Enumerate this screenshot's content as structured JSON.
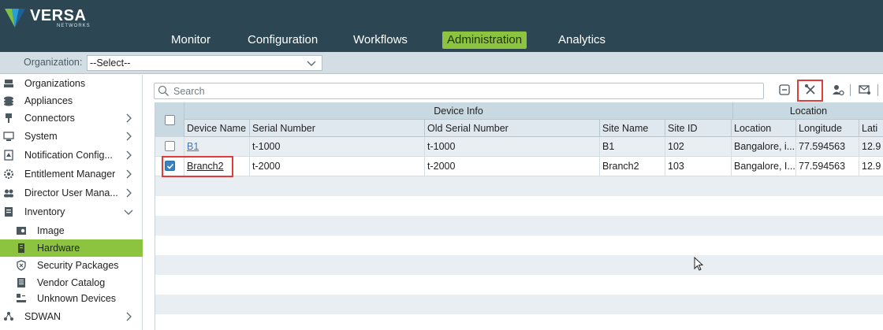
{
  "brand": {
    "name": "VERSA",
    "sub": "NETWORKS"
  },
  "nav": {
    "items": [
      {
        "label": "Monitor"
      },
      {
        "label": "Configuration"
      },
      {
        "label": "Workflows"
      },
      {
        "label": "Administration",
        "active": true
      },
      {
        "label": "Analytics"
      }
    ]
  },
  "org": {
    "label": "Organization:",
    "value": "--Select--"
  },
  "sidebar": {
    "items": [
      {
        "label": "Organizations",
        "icon": "organizations-icon"
      },
      {
        "label": "Appliances",
        "icon": "appliances-icon"
      },
      {
        "label": "Connectors",
        "icon": "connectors-icon",
        "arrow": "right"
      },
      {
        "label": "System",
        "icon": "system-icon",
        "arrow": "right"
      },
      {
        "label": "Notification Config...",
        "icon": "notification-icon",
        "arrow": "right"
      },
      {
        "label": "Entitlement Manager",
        "icon": "gear-icon",
        "arrow": "right"
      },
      {
        "label": "Director User Mana...",
        "icon": "users-icon",
        "arrow": "right"
      },
      {
        "label": "Inventory",
        "icon": "inventory-icon",
        "arrow": "down"
      },
      {
        "label": "Image",
        "icon": "image-icon",
        "sub": true
      },
      {
        "label": "Hardware",
        "icon": "hardware-icon",
        "sub": true,
        "selected": true
      },
      {
        "label": "Security Packages",
        "icon": "shield-icon",
        "sub": true
      },
      {
        "label": "Vendor Catalog",
        "icon": "catalog-icon",
        "sub": true
      },
      {
        "label": "Unknown Devices",
        "icon": "unknown-devices-icon",
        "sub": true
      },
      {
        "label": "SDWAN",
        "icon": "sdwan-icon",
        "arrow": "right"
      }
    ]
  },
  "search": {
    "placeholder": "Search"
  },
  "toolbar": {
    "icons": [
      "collapse-icon",
      "tools-icon",
      "user-settings-icon",
      "mail-icon"
    ],
    "highlight_color": "#e03c3c"
  },
  "grid": {
    "groups": [
      {
        "label": "Device Info"
      },
      {
        "label": "Location"
      }
    ],
    "columns": [
      "Device Name",
      "Serial Number",
      "Old Serial Number",
      "Site Name",
      "Site ID",
      "Location",
      "Longitude",
      "Lati"
    ],
    "rows": [
      {
        "checked": false,
        "cells": [
          "B1",
          "t-1000",
          "t-1000",
          "B1",
          "102",
          "Bangalore, i...",
          "77.594563",
          "12.9"
        ]
      },
      {
        "checked": true,
        "cells": [
          "Branch2",
          "t-2000",
          "t-2000",
          "Branch2",
          "103",
          "Bangalore, I...",
          "77.594563",
          "12.9"
        ]
      }
    ]
  },
  "colors": {
    "header_bg": "#2c4753",
    "accent_green": "#8cc43f",
    "header_row_bg": "#c8d9e2",
    "selection_blue": "#3b82c4",
    "highlight_red": "#e03c3c"
  }
}
